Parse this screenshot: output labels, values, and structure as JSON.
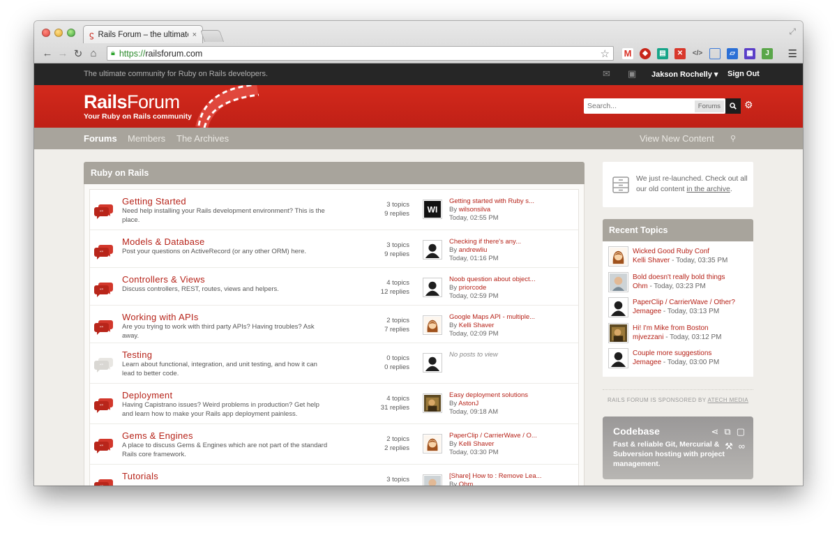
{
  "browser": {
    "tab_title": "Rails Forum – the ultimate",
    "tab_close": "×",
    "url_scheme": "https://",
    "url_host": "railsforum.com"
  },
  "site": {
    "tagline": "The ultimate community for Ruby on Rails developers.",
    "user_menu": "Jakson Rochelly ▾",
    "sign_out": "Sign Out",
    "logo_part1": "Rails",
    "logo_part2": "Forum",
    "logo_sub": "Your Ruby on Rails community",
    "search_placeholder": "Search...",
    "search_scope": "Forums"
  },
  "nav": {
    "forums": "Forums",
    "members": "Members",
    "archives": "The Archives",
    "view_new": "View New Content"
  },
  "section_title": "Ruby on Rails",
  "forums": [
    {
      "title": "Getting Started",
      "desc": "Need help installing your Rails development environment? This is the place.",
      "topics": "3 topics",
      "replies": "9 replies",
      "last_title": "Getting started with Ruby s...",
      "by_prefix": "By ",
      "last_user": "wilsonsilva",
      "last_time": "Today, 02:55 PM",
      "avatar": "wi"
    },
    {
      "title": "Models & Database",
      "desc": "Post your questions on ActiveRecord (or any other ORM) here.",
      "topics": "3 topics",
      "replies": "9 replies",
      "last_title": "Checking if there's any...",
      "by_prefix": "By ",
      "last_user": "andrewliu",
      "last_time": "Today, 01:16 PM",
      "avatar": "default"
    },
    {
      "title": "Controllers & Views",
      "desc": "Discuss controllers, REST, routes, views and helpers.",
      "topics": "4 topics",
      "replies": "12 replies",
      "last_title": "Noob question about object...",
      "by_prefix": "By ",
      "last_user": "priorcode",
      "last_time": "Today, 02:59 PM",
      "avatar": "default"
    },
    {
      "title": "Working with APIs",
      "desc": "Are you trying to work with third party APIs? Having troubles? Ask away.",
      "topics": "2 topics",
      "replies": "7 replies",
      "last_title": "Google Maps API - multiple...",
      "by_prefix": "By ",
      "last_user": "Kelli Shaver",
      "last_time": "Today, 02:09 PM",
      "avatar": "girl"
    },
    {
      "title": "Testing",
      "desc": "Learn about functional, integration, and unit testing, and how it can lead to better code.",
      "topics": "0 topics",
      "replies": "0 replies",
      "last_title": "",
      "by_prefix": "",
      "last_user": "",
      "last_time": "",
      "empty": "No posts to view",
      "avatar": "default",
      "muted": true
    },
    {
      "title": "Deployment",
      "desc": "Having Capistrano issues? Weird problems in production? Get help and learn how to make your Rails app deployment painless.",
      "topics": "4 topics",
      "replies": "31 replies",
      "last_title": "Easy deployment solutions",
      "by_prefix": "By ",
      "last_user": "AstonJ",
      "last_time": "Today, 09:18 AM",
      "avatar": "photo"
    },
    {
      "title": "Gems & Engines",
      "desc": "A place to discuss Gems & Engines which are not part of the standard Rails core framework.",
      "topics": "2 topics",
      "replies": "2 replies",
      "last_title": "PaperClip / CarrierWave / O...",
      "by_prefix": "By ",
      "last_user": "Kelli Shaver",
      "last_time": "Today, 03:30 PM",
      "avatar": "girl"
    },
    {
      "title": "Tutorials",
      "desc": "",
      "topics": "3 topics",
      "replies": "",
      "last_title": "[Share] How to : Remove Lea...",
      "by_prefix": "By ",
      "last_user": "Ohm",
      "last_time": "",
      "avatar": "man"
    }
  ],
  "notice": {
    "text": "We just re-launched. Check out all our old content ",
    "link": "in the archive",
    "end": "."
  },
  "recent": {
    "title": "Recent Topics",
    "items": [
      {
        "title": "Wicked Good Ruby Conf",
        "user": "Kelli Shaver",
        "time": " - Today, 03:35 PM",
        "avatar": "girl"
      },
      {
        "title": "Bold doesn't really bold things",
        "user": "Ohm",
        "time": " - Today, 03:23 PM",
        "avatar": "man"
      },
      {
        "title": "PaperClip / CarrierWave / Other?",
        "user": "Jemagee",
        "time": " - Today, 03:13 PM",
        "avatar": "default"
      },
      {
        "title": "Hi! I'm Mike from Boston",
        "user": "mjvezzani",
        "time": " - Today, 03:12 PM",
        "avatar": "photo"
      },
      {
        "title": "Couple more suggestions",
        "user": "Jemagee",
        "time": " - Today, 03:00 PM",
        "avatar": "default"
      }
    ]
  },
  "sponsor": {
    "text": "RAILS FORUM IS SPONSORED BY ",
    "link": "ATECH MEDIA"
  },
  "codebase": {
    "title": "Codebase",
    "text": "Fast & reliable Git, Mercurial & Subversion hosting with project management."
  },
  "colors": {
    "brand_red": "#c8261a",
    "topbar": "#262626",
    "nav_gray": "#a8a49c"
  }
}
